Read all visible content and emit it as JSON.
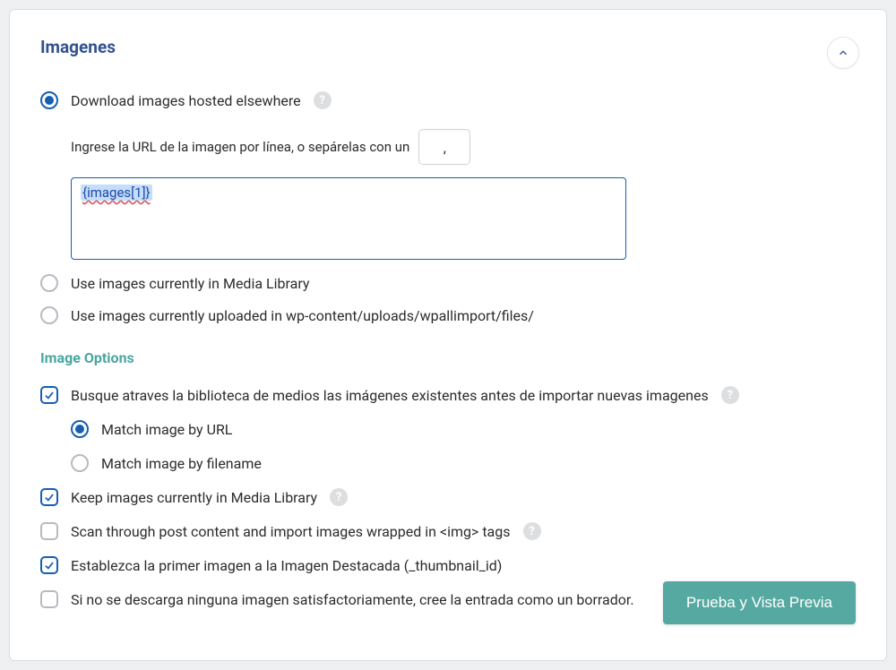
{
  "panel": {
    "title": "Imagenes",
    "radios": {
      "download": "Download images hosted elsewhere",
      "mediaLib": "Use images currently in Media Library",
      "uploads": "Use images currently uploaded in wp-content/uploads/wpallimport/files/"
    },
    "urlLine": {
      "desc": "Ingrese la URL de la imagen por línea, o sepárelas con un",
      "separator": ","
    },
    "textarea": {
      "value": "{images[1]}"
    },
    "optionsTitle": "Image Options",
    "opts": {
      "searchExisting": "Busque atraves la biblioteca de medios las imágenes existentes antes de importar nuevas imagenes",
      "matchUrl": "Match image by URL",
      "matchFilename": "Match image by filename",
      "keep": "Keep images currently in Media Library",
      "scan": "Scan through post content and import images wrapped in <img> tags",
      "featured": "Establezca la primer imagen a la Imagen Destacada (_thumbnail_id)",
      "draft": "Si no se descarga ninguna imagen satisfactoriamente, cree la entrada como un borrador."
    },
    "previewBtn": "Prueba y Vista Previa",
    "help": "?"
  }
}
